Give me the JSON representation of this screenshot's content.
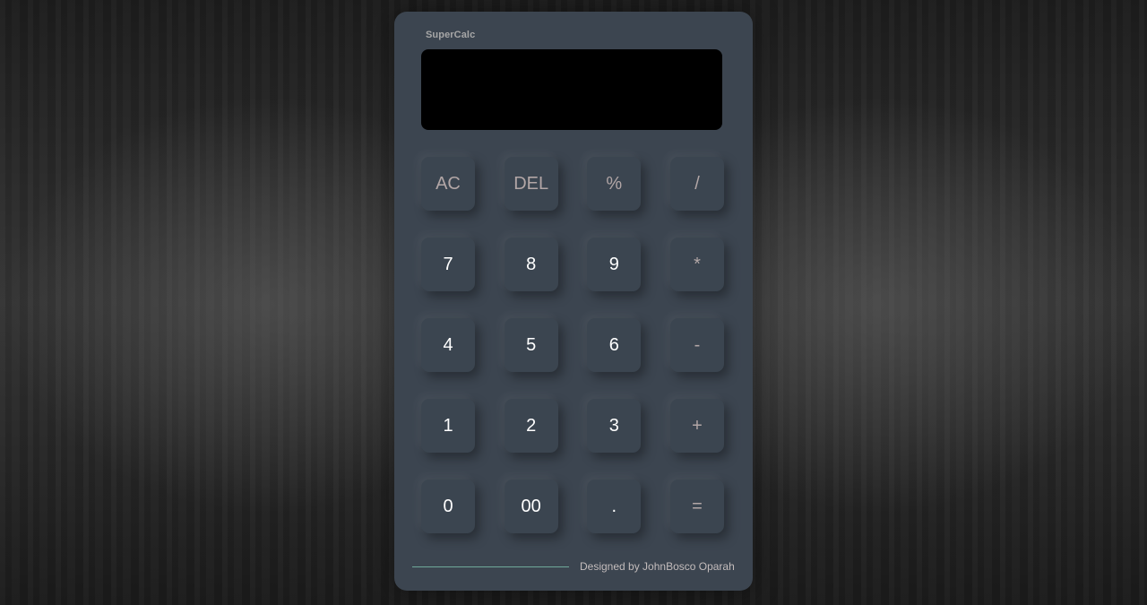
{
  "app": {
    "brand": "SuperCalc"
  },
  "display": {
    "value": ""
  },
  "keys": {
    "row1": [
      "AC",
      "DEL",
      "%",
      "/"
    ],
    "row2": [
      "7",
      "8",
      "9",
      "*"
    ],
    "row3": [
      "4",
      "5",
      "6",
      "-"
    ],
    "row4": [
      "1",
      "2",
      "3",
      "+"
    ],
    "row5": [
      "0",
      "00",
      ".",
      "="
    ]
  },
  "footer": {
    "credit": "Designed by JohnBosco Oparah"
  },
  "colors": {
    "body_background": "#2a2a2a",
    "calculator_body": "#3c4550",
    "display_background": "#000000",
    "number_key_text": "#ffffff",
    "operator_key_text": "#b2a6a6",
    "footer_line": "#6fa99a"
  }
}
